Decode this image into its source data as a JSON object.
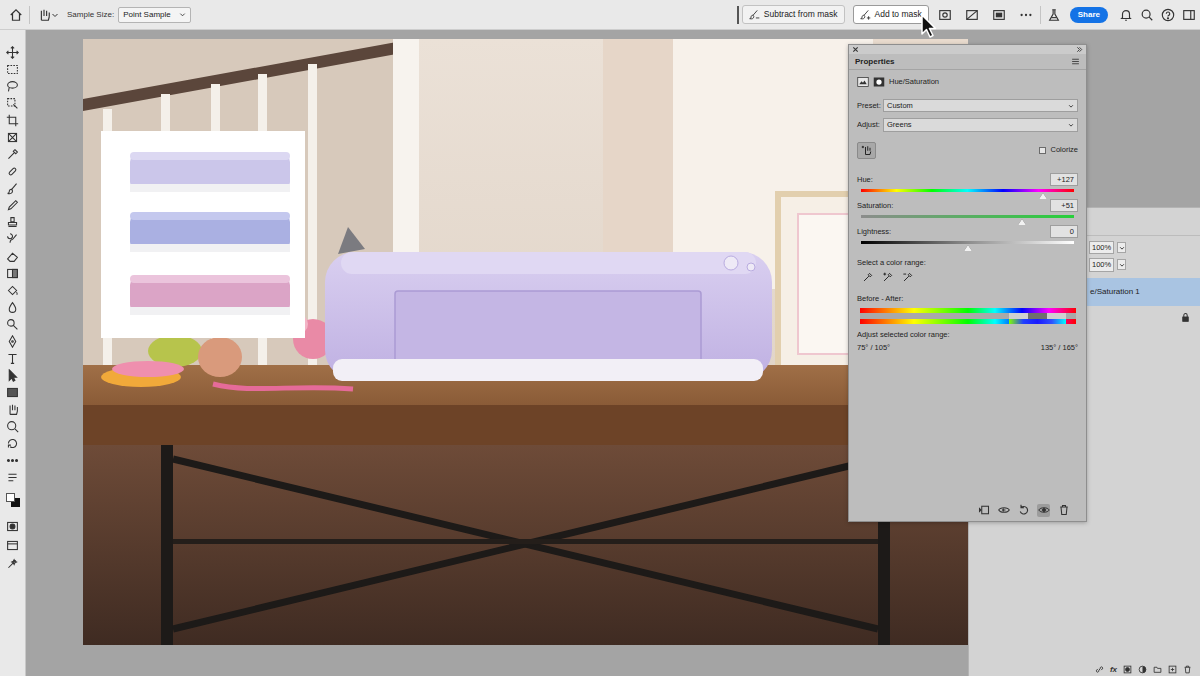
{
  "options_bar": {
    "sample_size_label": "Sample Size:",
    "sample_size": "Point Sample",
    "buttons": [
      {
        "label": "Subtract from mask",
        "hovered": false
      },
      {
        "label": "Add to mask",
        "hovered": true
      }
    ],
    "share": "Share"
  },
  "properties": {
    "title": "Properties",
    "adjustment": "Hue/Saturation",
    "preset_label": "Preset:",
    "preset": "Custom",
    "adjust_label": "Adjust:",
    "adjust": "Greens",
    "colorize": {
      "label": "Colorize",
      "checked": false
    },
    "sliders": [
      {
        "label": "Hue:",
        "reading": "+127",
        "level": 0.853,
        "kind": "hue"
      },
      {
        "label": "Saturation:",
        "reading": "+51",
        "level": 0.755,
        "kind": "saturation"
      },
      {
        "label": "Lightness:",
        "reading": "0",
        "level": 0.5,
        "kind": "lightness"
      }
    ],
    "color_range_label": "Select a color range:",
    "before_after_label": "Before - After:",
    "range_label": "Adjust selected color range:",
    "range_values": [
      "75° / 105°",
      "135° / 165°"
    ],
    "range_degrees": [
      75,
      105,
      135,
      165
    ],
    "visibility": {
      "on": true
    }
  },
  "layers": {
    "opacity": "100%",
    "fill": "100%",
    "rows": [
      {
        "name": "e/Saturation 1",
        "selected": true
      }
    ],
    "background_locked": true,
    "fx": "fx"
  }
}
